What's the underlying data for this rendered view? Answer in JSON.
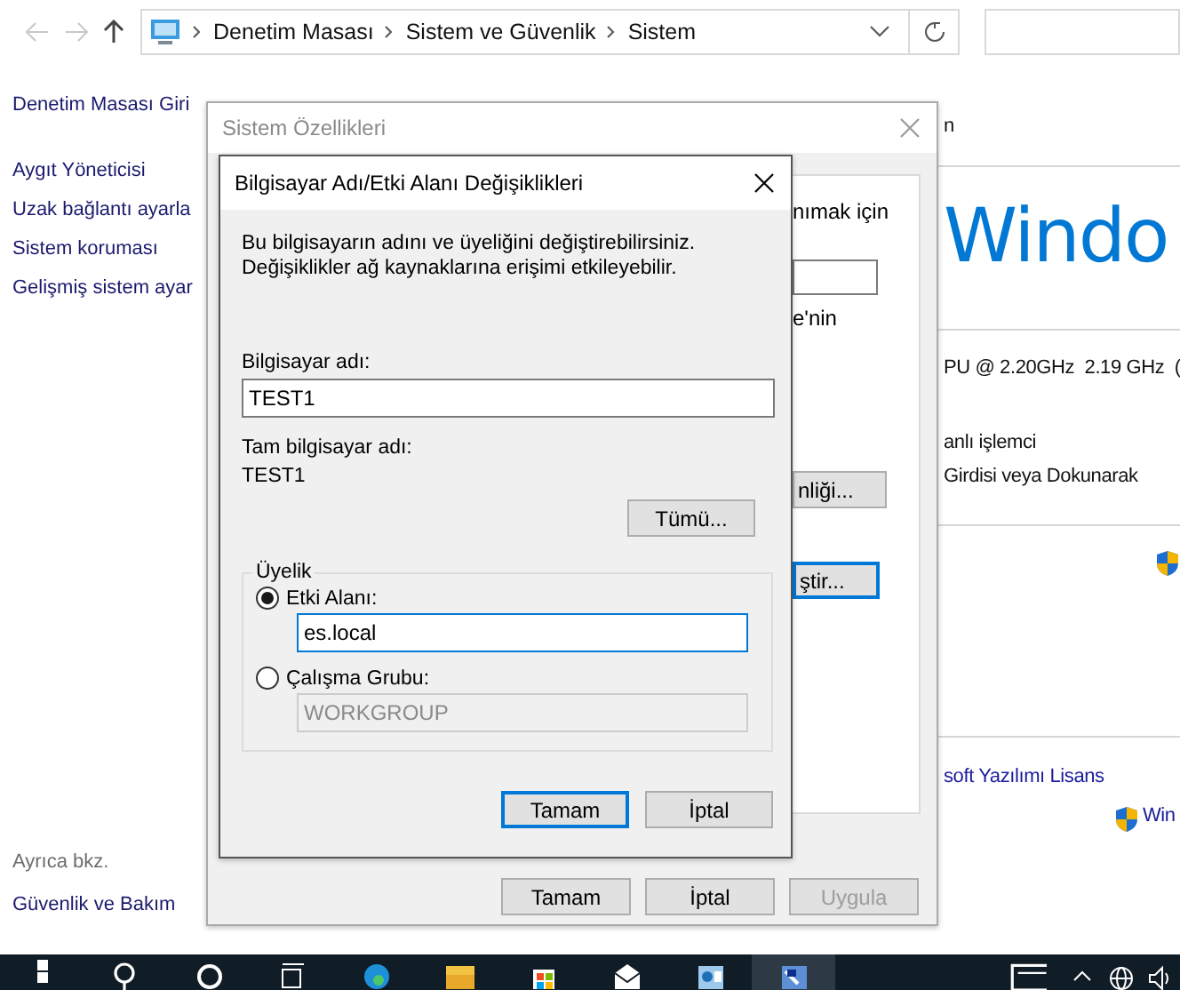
{
  "address_bar": {
    "path": [
      "Denetim Masası",
      "Sistem ve Güvenlik",
      "Sistem"
    ]
  },
  "sidebar": {
    "links": [
      "Denetim Masası Giri",
      "Aygıt Yöneticisi",
      "Uzak bağlantı ayarla",
      "Sistem koruması",
      "Gelişmiş sistem ayar"
    ],
    "see_also_heading": "Ayrıca bkz.",
    "see_also_links": [
      "Güvenlik ve Bakım"
    ]
  },
  "main": {
    "header_fragment": "n",
    "logo_fragment": "Windo",
    "processor_fragment": "PU @ 2.20GHz  2.19 GHz  (",
    "system_type_fragment": "anlı işlemci",
    "pen_fragment": "Girdisi veya Dokunarak",
    "license_fragment": "soft Yazılımı Lisans",
    "activation_fragment": "Win"
  },
  "system_properties": {
    "title": "Sistem Özellikleri",
    "active": false,
    "panel_texts": [
      "nımak için",
      "e'nin"
    ],
    "panel_buttons": [
      {
        "label": "nliği...",
        "focused": false
      },
      {
        "label": "ştir...",
        "focused": true
      }
    ],
    "buttons": [
      {
        "label": "Tamam",
        "disabled": false
      },
      {
        "label": "İptal",
        "disabled": false
      },
      {
        "label": "Uygula",
        "disabled": true
      }
    ]
  },
  "dialog": {
    "title": "Bilgisayar Adı/Etki Alanı Değişiklikleri",
    "active": true,
    "description": "Bu bilgisayarın adını ve üyeliğini değiştirebilirsiniz. Değişiklikler ağ kaynaklarına erişimi etkileyebilir.",
    "computer_name_label": "Bilgisayar adı:",
    "computer_name": "TEST1",
    "full_name_label": "Tam bilgisayar adı:",
    "full_name": "TEST1",
    "more_button": "Tümü...",
    "membership": {
      "title": "Üyelik",
      "options": [
        {
          "label": "Etki Alanı:",
          "selected": true,
          "value": "es.local"
        },
        {
          "label": "Çalışma Grubu:",
          "selected": false,
          "value": "WORKGROUP"
        }
      ]
    },
    "buttons": [
      {
        "label": "Tamam",
        "default": true
      },
      {
        "label": "İptal",
        "default": false
      }
    ]
  },
  "taskbar": {
    "apps": [
      {
        "kind": "start",
        "active": false
      },
      {
        "kind": "search",
        "active": false
      },
      {
        "kind": "cortana",
        "active": false
      },
      {
        "kind": "task_view",
        "active": false
      },
      {
        "kind": "edge",
        "active": false
      },
      {
        "kind": "explorer",
        "active": false
      },
      {
        "kind": "store",
        "active": false
      },
      {
        "kind": "mail",
        "active": false
      },
      {
        "kind": "server_manager",
        "active": false
      },
      {
        "kind": "control_panel",
        "active": true
      }
    ],
    "tray": [
      {
        "kind": "news"
      },
      {
        "kind": "chevron"
      },
      {
        "kind": "network"
      },
      {
        "kind": "volume"
      }
    ]
  }
}
